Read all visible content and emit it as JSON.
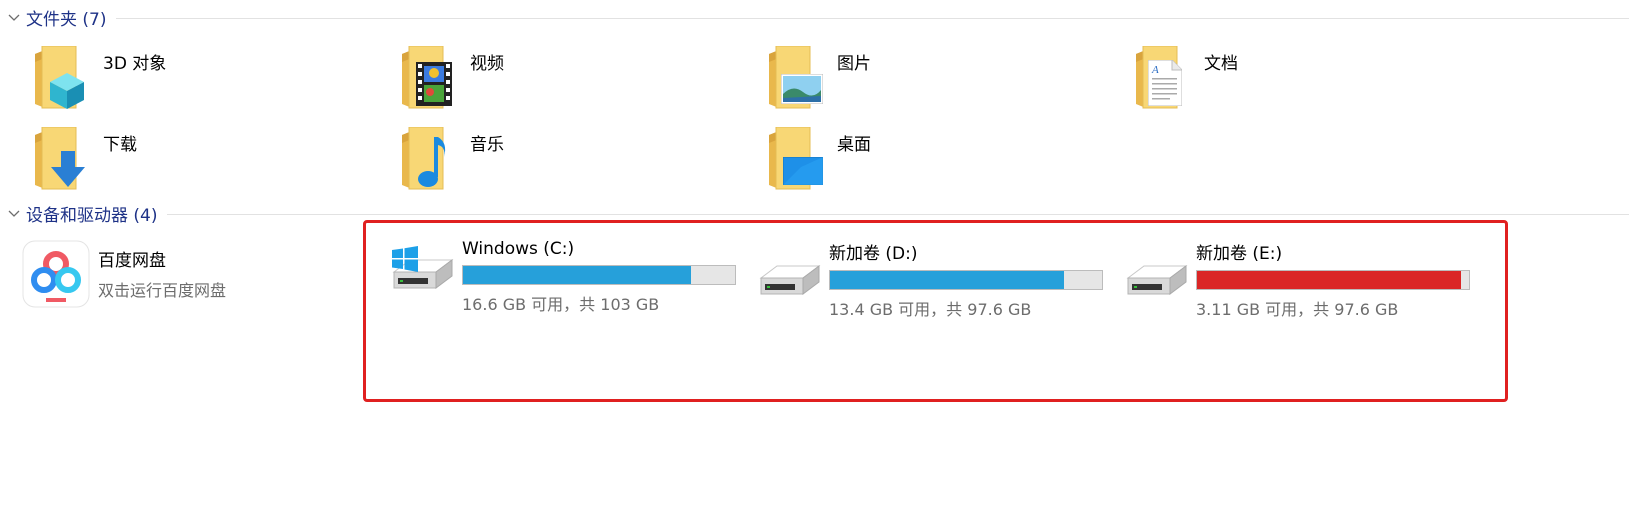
{
  "groups": {
    "folders": {
      "title": "文件夹 (7)"
    },
    "devices": {
      "title": "设备和驱动器 (4)"
    }
  },
  "folders": [
    {
      "name": "3D 对象",
      "icon": "3d-objects-icon"
    },
    {
      "name": "视频",
      "icon": "videos-icon"
    },
    {
      "name": "图片",
      "icon": "pictures-icon"
    },
    {
      "name": "文档",
      "icon": "documents-icon"
    },
    {
      "name": "下载",
      "icon": "downloads-icon"
    },
    {
      "name": "音乐",
      "icon": "music-icon"
    },
    {
      "name": "桌面",
      "icon": "desktop-icon"
    }
  ],
  "app": {
    "name": "百度网盘",
    "subtitle": "双击运行百度网盘",
    "icon": "baidu-netdisk-icon"
  },
  "drives": [
    {
      "name": "Windows (C:)",
      "space": "16.6 GB 可用，共 103 GB",
      "used_fraction": 0.84,
      "low_space": false,
      "icon": "windows-drive-icon"
    },
    {
      "name": "新加卷 (D:)",
      "space": "13.4 GB 可用，共 97.6 GB",
      "used_fraction": 0.86,
      "low_space": false,
      "icon": "hard-drive-icon"
    },
    {
      "name": "新加卷 (E:)",
      "space": "3.11 GB 可用，共 97.6 GB",
      "used_fraction": 0.97,
      "low_space": true,
      "icon": "hard-drive-icon"
    }
  ],
  "colors": {
    "group_title": "#1e3287",
    "usage_bar": "#26a0da",
    "usage_bar_low": "#da2626",
    "highlight_box": "#e02020",
    "folder_yellow": "#f8d775"
  }
}
